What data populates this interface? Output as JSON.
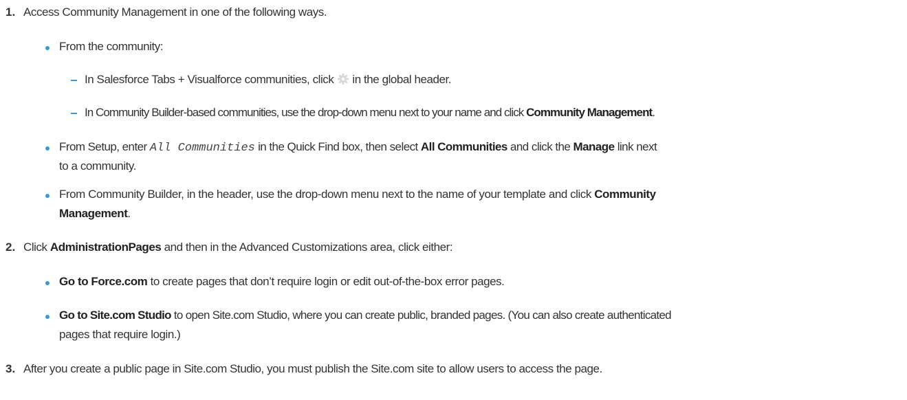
{
  "steps": [
    {
      "number": "1.",
      "text": "Access Community Management in one of the following ways.",
      "bullets": [
        {
          "text": "From the community:",
          "subitems": [
            {
              "before_icon": "In Salesforce Tabs + Visualforce communities, click",
              "icon": "gear-icon",
              "after_icon": "in the global header."
            },
            {
              "prefix": "In Community Builder-based communities, use the drop-down menu next to your name and click ",
              "bold": "Community Management",
              "suffix": "."
            }
          ]
        },
        {
          "line1_prefix": "From Setup, enter",
          "code": "All Communities",
          "line1_middle": "in the Quick Find box, then select",
          "bold1": "All Communities",
          "line1_and": "and click the",
          "bold2": "Manage",
          "line1_suffix": "link next",
          "line2": "to a community."
        },
        {
          "line1": "From Community Builder, in the header, use the drop-down menu next to the name of your template and click",
          "bold_line1": "Community",
          "bold_line2": "Management",
          "suffix": "."
        }
      ]
    },
    {
      "number": "2.",
      "prefix": "Click",
      "bold": "AdministrationPages",
      "suffix": "and then in the Advanced Customizations area, click either:",
      "bullets": [
        {
          "bold": "Go to Force.com",
          "text": "to create pages that don’t require login or edit out-of-the-box error pages."
        },
        {
          "bold": "Go to Site.com Studio",
          "text": "to open Site.com Studio, where you can create public, branded pages. (You can also create authenticated",
          "line2": "pages that require login.)"
        }
      ]
    },
    {
      "number": "3.",
      "text": "After you create a public page in Site.com Studio, you must publish the Site.com site to allow users to access the page."
    }
  ],
  "colors": {
    "bullet": "#2d9cdb",
    "text": "#333333"
  }
}
